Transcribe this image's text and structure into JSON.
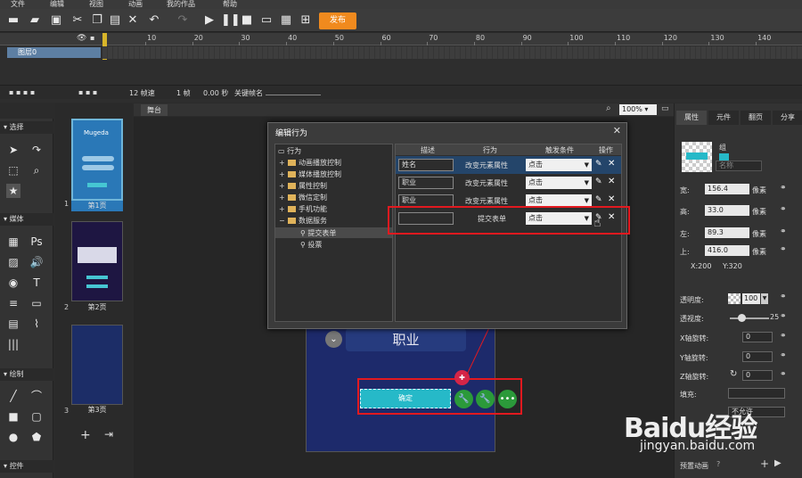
{
  "menubar": {
    "items": [
      "文件",
      "编辑",
      "视图",
      "动画",
      "我的作品",
      "帮助"
    ]
  },
  "toolbar": {
    "publish": "发布"
  },
  "timeline": {
    "ruler": [
      "10",
      "20",
      "30",
      "40",
      "50",
      "60",
      "70",
      "80",
      "90",
      "100",
      "110",
      "120",
      "130",
      "140"
    ],
    "layer_name": "图层0",
    "fps": "12 帧速",
    "frame": "1 帧",
    "time": "0.00 秒",
    "keyframe_label": "关键帧名"
  },
  "tools": {
    "select": "选择",
    "media": "媒体",
    "draw": "绘制",
    "controls": "控件"
  },
  "pages": {
    "items": [
      {
        "num": "1",
        "label": "第1页",
        "brand": "Mugeda"
      },
      {
        "num": "2",
        "label": "第2页"
      },
      {
        "num": "3",
        "label": "第3页"
      }
    ]
  },
  "stage": {
    "tab": "舞台",
    "zoom": "100%",
    "job_field": "职业",
    "confirm": "确定"
  },
  "dialog": {
    "title": "编辑行为",
    "tree": {
      "root": "行为",
      "folders": [
        "动画播放控制",
        "媒体播放控制",
        "属性控制",
        "微信定制",
        "手机功能",
        "数据服务"
      ],
      "children": [
        "提交表单",
        "投票"
      ]
    },
    "columns": [
      "描述",
      "行为",
      "触发条件",
      "操作"
    ],
    "rows": [
      {
        "desc": "姓名",
        "action": "改变元素属性",
        "trigger": "点击"
      },
      {
        "desc": "职业",
        "action": "改变元素属性",
        "trigger": "点击"
      },
      {
        "desc": "职业",
        "action": "改变元素属性",
        "trigger": "点击"
      },
      {
        "desc": "",
        "action": "提交表单",
        "trigger": "点击"
      }
    ]
  },
  "props": {
    "tabs": [
      "属性",
      "元件",
      "翻页",
      "分享"
    ],
    "group_label": "组",
    "name_placeholder": "名称",
    "width_label": "宽:",
    "width": "156.4",
    "height_label": "高:",
    "height": "33.0",
    "left_label": "左:",
    "left": "89.3",
    "top_label": "上:",
    "top": "416.0",
    "unit": "像素",
    "x": "X:200",
    "y": "Y:320",
    "opacity_label": "透明度:",
    "opacity": "100",
    "blur_label": "透视度:",
    "blur": "25",
    "rotx_label": "X轴旋转:",
    "rotx": "0",
    "roty_label": "Y轴旋转:",
    "roty": "0",
    "rotz_label": "Z轴旋转:",
    "rotz": "0",
    "fill_label": "填充:",
    "fill_val": "不允许",
    "preset_label": "预置动画"
  },
  "watermark": {
    "brand": "Baidu经验",
    "url": "jingyan.baidu.com"
  }
}
